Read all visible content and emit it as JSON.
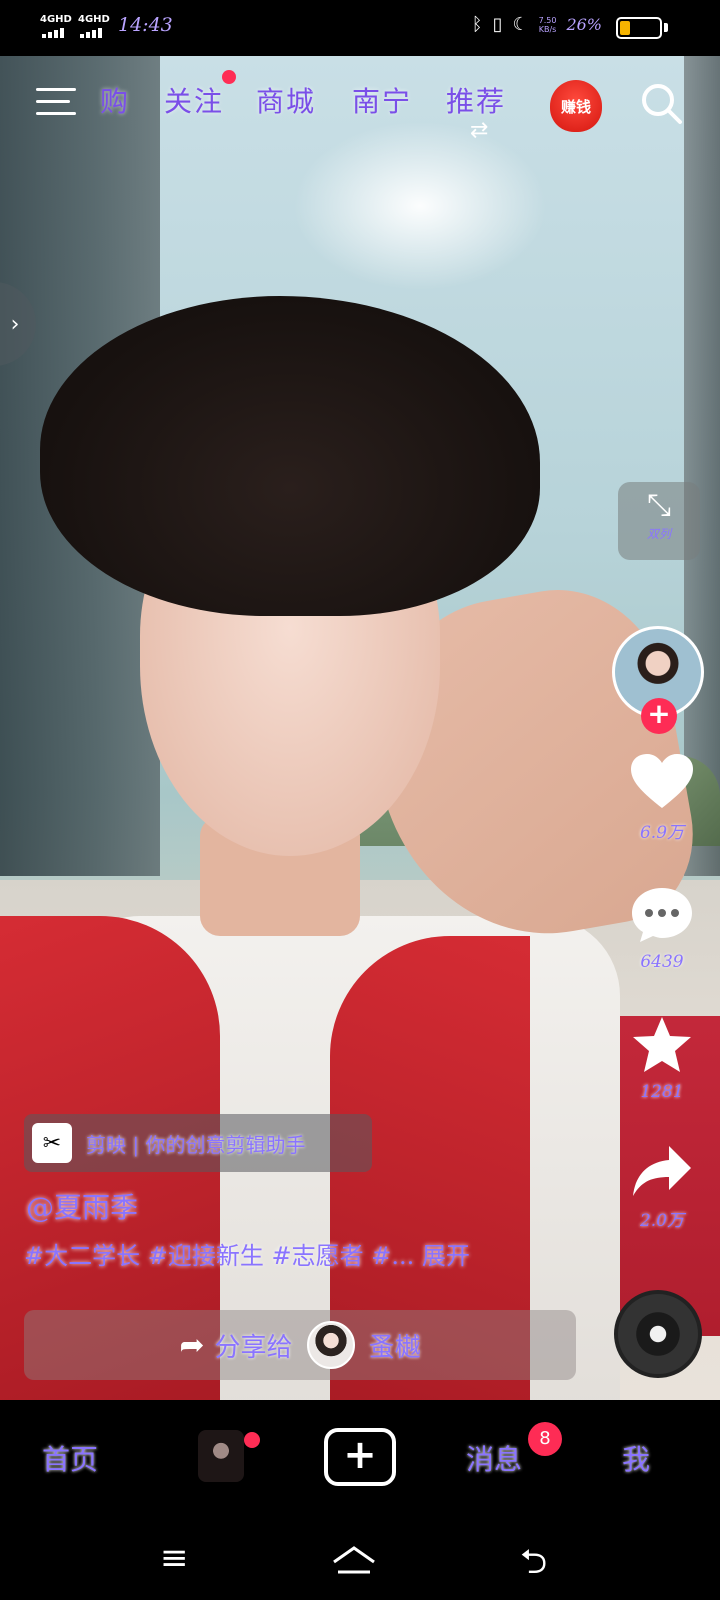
{
  "status_bar": {
    "network_1": "4GHD",
    "network_2": "4GHD",
    "time": "14:43",
    "speed_value": "7.50",
    "speed_unit": "KB/s",
    "battery_percent": "26%",
    "battery_level": 0.26
  },
  "top_nav": {
    "tabs": [
      "购",
      "关注",
      "商城",
      "南宁",
      "推荐"
    ],
    "earn_label": "赚钱",
    "accent_color": "#7a4fe8"
  },
  "right_actions": {
    "compress_label": "双列",
    "likes": "6.9万",
    "comments": "6439",
    "favorites": "1281",
    "shares": "2.0万"
  },
  "video_info": {
    "capcut_text": "剪映 | 你的创意剪辑助手",
    "author": "@夏雨季",
    "hashtags": "#大二学长 #迎接新生 #志愿者 #...  展开",
    "share_label": "分享给",
    "share_target": "蚤樾"
  },
  "tab_bar": {
    "home": "首页",
    "messages": "消息",
    "messages_badge": "8",
    "me": "我"
  },
  "icons": {
    "menu": "menu-icon",
    "search": "search-icon",
    "like": "heart-icon",
    "comment": "comment-icon",
    "favorite": "star-icon",
    "share": "share-icon",
    "create": "plus-icon"
  }
}
